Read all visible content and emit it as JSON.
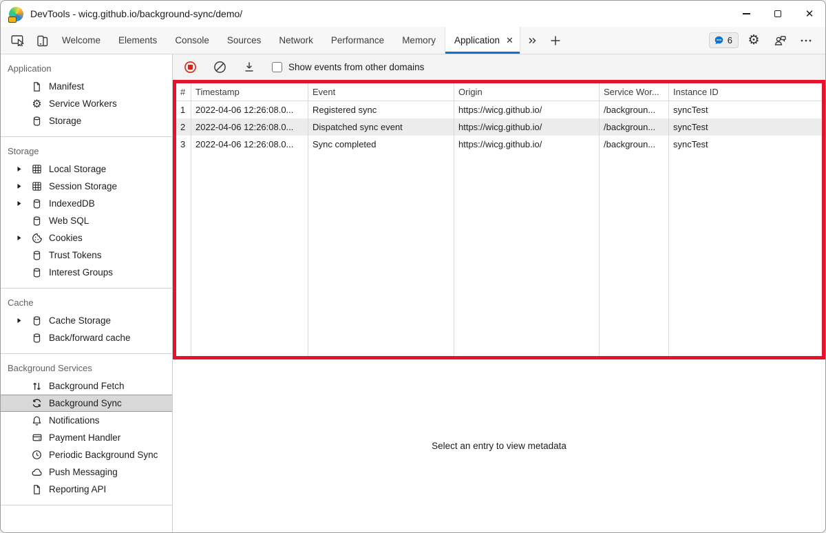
{
  "window": {
    "title": "DevTools - wicg.github.io/background-sync/demo/"
  },
  "tabs": {
    "items": [
      "Welcome",
      "Elements",
      "Console",
      "Sources",
      "Network",
      "Performance",
      "Memory"
    ],
    "active": "Application",
    "issues_badge_count": "6"
  },
  "sidebar": {
    "sections": [
      {
        "title": "Application",
        "items": [
          {
            "label": "Manifest",
            "icon": "document-icon"
          },
          {
            "label": "Service Workers",
            "icon": "gear-icon"
          },
          {
            "label": "Storage",
            "icon": "database-icon"
          }
        ]
      },
      {
        "title": "Storage",
        "items": [
          {
            "label": "Local Storage",
            "icon": "table-grid-icon",
            "expandable": true
          },
          {
            "label": "Session Storage",
            "icon": "table-grid-icon",
            "expandable": true
          },
          {
            "label": "IndexedDB",
            "icon": "database-icon",
            "expandable": true
          },
          {
            "label": "Web SQL",
            "icon": "database-icon",
            "expandable": false
          },
          {
            "label": "Cookies",
            "icon": "cookie-icon",
            "expandable": true
          },
          {
            "label": "Trust Tokens",
            "icon": "database-icon",
            "expandable": false
          },
          {
            "label": "Interest Groups",
            "icon": "database-icon",
            "expandable": false
          }
        ]
      },
      {
        "title": "Cache",
        "items": [
          {
            "label": "Cache Storage",
            "icon": "database-icon",
            "expandable": true
          },
          {
            "label": "Back/forward cache",
            "icon": "database-icon",
            "expandable": false
          }
        ]
      },
      {
        "title": "Background Services",
        "items": [
          {
            "label": "Background Fetch",
            "icon": "up-down-arrows-icon"
          },
          {
            "label": "Background Sync",
            "icon": "sync-icon",
            "selected": true
          },
          {
            "label": "Notifications",
            "icon": "bell-icon"
          },
          {
            "label": "Payment Handler",
            "icon": "payment-card-icon"
          },
          {
            "label": "Periodic Background Sync",
            "icon": "clock-icon"
          },
          {
            "label": "Push Messaging",
            "icon": "cloud-icon"
          },
          {
            "label": "Reporting API",
            "icon": "document-icon"
          }
        ]
      }
    ]
  },
  "toolbar": {
    "record_icon": "record-stop-icon",
    "clear_icon": "block-icon",
    "save_icon": "download-icon",
    "checkbox_checked": false,
    "checkbox_label": "Show events from other domains"
  },
  "table": {
    "columns": [
      "#",
      "Timestamp",
      "Event",
      "Origin",
      "Service Wor...",
      "Instance ID"
    ],
    "rows": [
      {
        "num": "1",
        "timestamp": "2022-04-06 12:26:08.0...",
        "event": "Registered sync",
        "origin": "https://wicg.github.io/",
        "service_worker": "/backgroun...",
        "instance_id": "syncTest"
      },
      {
        "num": "2",
        "timestamp": "2022-04-06 12:26:08.0...",
        "event": "Dispatched sync event",
        "origin": "https://wicg.github.io/",
        "service_worker": "/backgroun...",
        "instance_id": "syncTest"
      },
      {
        "num": "3",
        "timestamp": "2022-04-06 12:26:08.0...",
        "event": "Sync completed",
        "origin": "https://wicg.github.io/",
        "service_worker": "/backgroun...",
        "instance_id": "syncTest"
      }
    ]
  },
  "metadata": {
    "empty_text": "Select an entry to view metadata"
  },
  "colors": {
    "accent_blue": "#0b72d7",
    "highlight_red": "#e8112d",
    "record_red": "#d62516",
    "selected_item_bg": "#d8d8d8",
    "stripe_row_bg": "#ececec"
  }
}
